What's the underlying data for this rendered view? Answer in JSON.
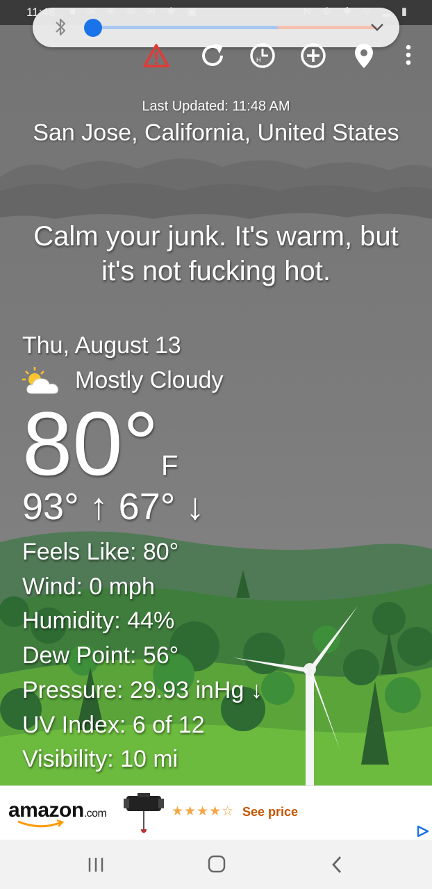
{
  "status_bar": {
    "time": "11:48",
    "left_icons": "■ ✉ ✉ ✉ ✉ ❀ ▣",
    "right_icons": "N ⚙ ✱ ▽ ▂ ▮"
  },
  "bluetooth_panel": {
    "icon": "bluetooth-icon",
    "volume_level": 0.65,
    "accent": "#1a73e8"
  },
  "toolbar": {
    "icons": [
      "warning-icon",
      "refresh-icon",
      "hourly-icon",
      "add-location-icon",
      "location-pin-icon",
      "more-options-icon"
    ],
    "warning_color": "#e53935"
  },
  "header": {
    "last_updated": "Last Updated: 11:48 AM",
    "location": "San Jose, California, United States"
  },
  "quip": "Calm your junk. It's warm, but it's not fucking hot.",
  "weather": {
    "date": "Thu, August 13",
    "condition": "Mostly Cloudy",
    "condition_icon": "partly-cloudy-icon",
    "temperature": "80°",
    "unit": "F",
    "high_low": "93° ↑ 67° ↓",
    "details": [
      "Feels Like: 80°",
      "Wind: 0 mph",
      "Humidity: 44%",
      "Dew Point: 56°",
      "Pressure: 29.93 inHg ↓",
      "UV Index: 6 of 12",
      "Visibility: 10 mi"
    ]
  },
  "ad": {
    "brand": "amazon",
    "brand_suffix": ".com",
    "stars": "★★★★",
    "stars_empty": "☆",
    "rating": 4,
    "cta": "See price",
    "adchoices_icon": "adchoices-icon"
  },
  "nav_bar": {
    "icons": [
      "recent-apps-icon",
      "home-icon",
      "back-icon"
    ]
  }
}
